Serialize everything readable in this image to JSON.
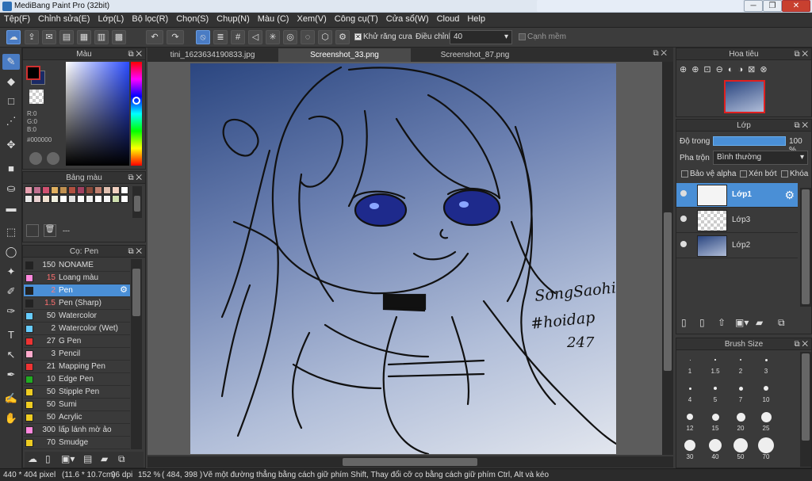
{
  "window": {
    "title": "MediBang Paint Pro (32bit)",
    "min": "─",
    "max": "❐",
    "close": "✕"
  },
  "menu": [
    "Tệp(F)",
    "Chỉnh sửa(E)",
    "Lớp(L)",
    "Bộ lọc(R)",
    "Chọn(S)",
    "Chụp(N)",
    "Màu (C)",
    "Xem(V)",
    "Công cụ(T)",
    "Cửa sổ(W)",
    "Cloud",
    "Help"
  ],
  "toolbar": {
    "antialias_label": "Khử răng cưa",
    "correction_label": "Điều chỉnh",
    "correction_value": "40",
    "edge_label": "Cạnh mềm"
  },
  "tabs": [
    "tini_1623634190833.jpg",
    "Screenshot_33.png",
    "Screenshot_87.png"
  ],
  "color_panel": {
    "title": "Màu",
    "r": "R:0",
    "g": "G:0",
    "b": "B:0",
    "hex": "#000000",
    "primary": "#000000",
    "secondary": "#1a2a66"
  },
  "palette_panel": {
    "title": "Bảng màu",
    "colors": [
      "#e6a0b0",
      "#c07090",
      "#d05070",
      "#e0b060",
      "#c09050",
      "#b05040",
      "#a04060",
      "#8a4a3a",
      "#c08070",
      "#e0c0b0",
      "#f0d0c0",
      "#ffffff",
      "#e8e8e8",
      "#e8d0d0",
      "#f0e0d0",
      "#f0f0e0",
      "#ffffff",
      "#e0e0e0",
      "#fafafa",
      "#f0f0f0",
      "#ffffff",
      "#f4f4f4",
      "#d0e0b0",
      "#ffffff"
    ],
    "more": "---"
  },
  "brush_panel": {
    "title": "Cọ: Pen",
    "brushes": [
      {
        "size": "150",
        "name": "NONAME",
        "color": "#222222"
      },
      {
        "size": "15",
        "name": "Loang màu",
        "color": "#ff88dd"
      },
      {
        "size": "2",
        "name": "Pen",
        "color": "#222222"
      },
      {
        "size": "1.5",
        "name": "Pen (Sharp)",
        "color": "#222222"
      },
      {
        "size": "50",
        "name": "Watercolor",
        "color": "#66ccff"
      },
      {
        "size": "2",
        "name": "Watercolor (Wet)",
        "color": "#66ccff"
      },
      {
        "size": "27",
        "name": "G Pen",
        "color": "#ee3333"
      },
      {
        "size": "3",
        "name": "Pencil",
        "color": "#ffaacc"
      },
      {
        "size": "21",
        "name": "Mapping Pen",
        "color": "#ee3333"
      },
      {
        "size": "10",
        "name": "Edge Pen",
        "color": "#22aa22"
      },
      {
        "size": "50",
        "name": "Stipple Pen",
        "color": "#eecc22"
      },
      {
        "size": "50",
        "name": "Sumi",
        "color": "#eecc22"
      },
      {
        "size": "50",
        "name": "Acrylic",
        "color": "#eecc22"
      },
      {
        "size": "300",
        "name": "lấp lánh mờ ảo",
        "color": "#ff88dd"
      },
      {
        "size": "70",
        "name": "Smudge",
        "color": "#eecc22"
      }
    ]
  },
  "navigator": {
    "title": "Hoa tiêu"
  },
  "layer_panel": {
    "title": "Lớp",
    "opacity_label": "Độ trong",
    "opacity_value": "100 %",
    "blend_label": "Pha trộn",
    "blend_value": "Bình thường",
    "protect_alpha": "Bảo vệ alpha",
    "clipping": "Xén bớt",
    "lock": "Khóa",
    "layers": [
      {
        "name": "Lớp1"
      },
      {
        "name": "Lớp3"
      },
      {
        "name": "Lớp2"
      }
    ]
  },
  "brush_size_panel": {
    "title": "Brush Size",
    "sizes": [
      "1",
      "1.5",
      "2",
      "3",
      "4",
      "5",
      "7",
      "10",
      "12",
      "15",
      "20",
      "25",
      "30",
      "40",
      "50",
      "70"
    ]
  },
  "artwork": {
    "signature_line1": "SongSaohi",
    "signature_line2": "#hoidap",
    "signature_line3": "247"
  },
  "status": {
    "dimensions": "440 * 404 pixel",
    "physical": "(11.6 * 10.7cm)",
    "dpi": "96 dpi",
    "zoom": "152 %",
    "coords": "( 484, 398 )",
    "hint": "Vẽ một đường thẳng bằng cách giữ phím Shift, Thay đổi cỡ cọ bằng cách giữ phím Ctrl, Alt và kéo"
  }
}
